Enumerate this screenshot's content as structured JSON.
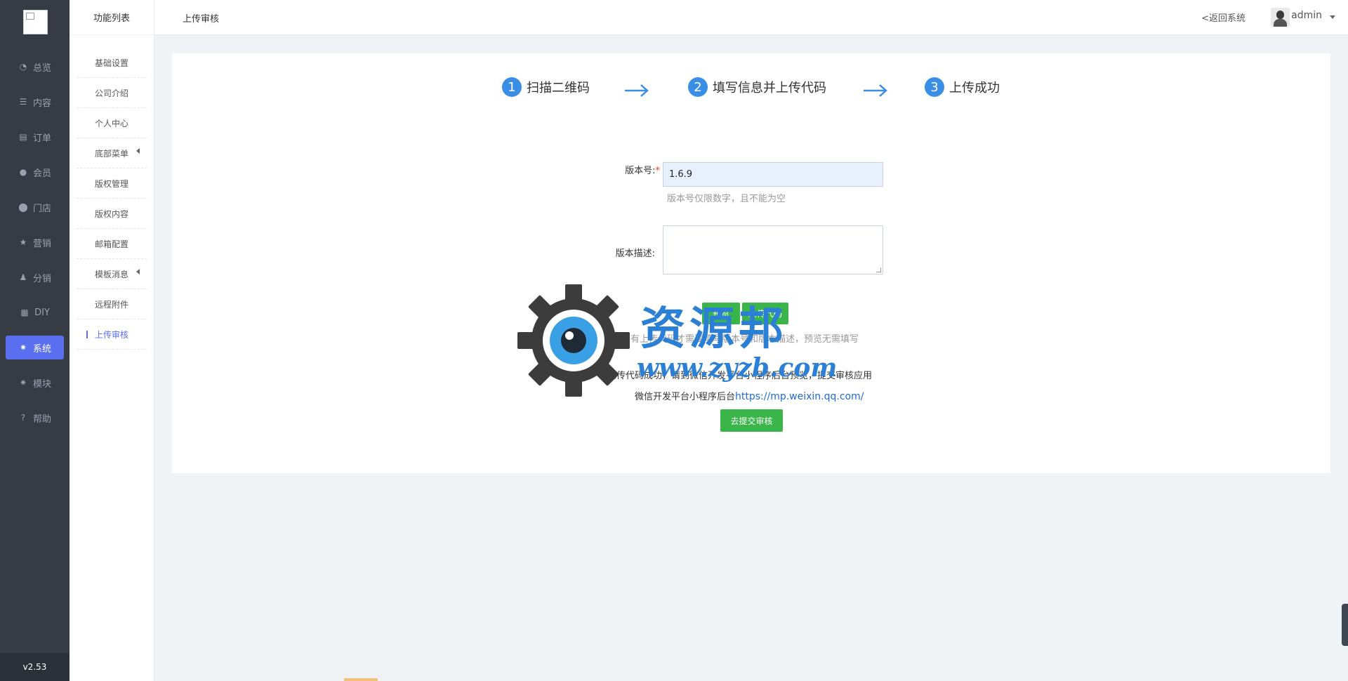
{
  "sidebar": {
    "items": [
      {
        "label": "总览",
        "icon": "pie-chart-icon",
        "glyph": "◔"
      },
      {
        "label": "内容",
        "icon": "list-icon",
        "glyph": "☰"
      },
      {
        "label": "订单",
        "icon": "order-icon",
        "glyph": "▤"
      },
      {
        "label": "会员",
        "icon": "user-icon",
        "glyph": "●"
      },
      {
        "label": "门店",
        "icon": "map-marker-icon",
        "glyph": "⬤"
      },
      {
        "label": "营销",
        "icon": "star-icon",
        "glyph": "★"
      },
      {
        "label": "分销",
        "icon": "users-icon",
        "glyph": "♟"
      },
      {
        "label": "DIY",
        "icon": "layout-icon",
        "glyph": "▦"
      },
      {
        "label": "系统",
        "icon": "gear-icon",
        "glyph": "✷",
        "active": true
      },
      {
        "label": "模块",
        "icon": "cog-icon",
        "glyph": "✷"
      },
      {
        "label": "帮助",
        "icon": "question-icon",
        "glyph": "?"
      }
    ],
    "version": "v2.53"
  },
  "submenu": {
    "title": "功能列表",
    "items": [
      {
        "label": "基础设置"
      },
      {
        "label": "公司介绍"
      },
      {
        "label": "个人中心"
      },
      {
        "label": "底部菜单",
        "has_caret": true
      },
      {
        "label": "版权管理"
      },
      {
        "label": "版权内容"
      },
      {
        "label": "邮箱配置"
      },
      {
        "label": "模板消息",
        "has_caret": true
      },
      {
        "label": "远程附件"
      },
      {
        "label": "上传审核",
        "active": true
      }
    ]
  },
  "header": {
    "title": "上传审核",
    "back_label": "<返回系统",
    "username": "admin"
  },
  "steps": [
    {
      "num": "1",
      "label": "扫描二维码"
    },
    {
      "num": "2",
      "label": "填写信息并上传代码"
    },
    {
      "num": "3",
      "label": "上传成功"
    }
  ],
  "form": {
    "version_label": "版本号:",
    "required_mark": "*",
    "version_value": "1.6.9",
    "version_hint": "版本号仅限数字，且不能为空",
    "desc_label": "版本描述:",
    "preview_button": "预览",
    "upload_button": "上传代码",
    "note_text": "只有上传代码才需要填写版本号和版本描述，预览无需填写",
    "success_text": "上传代码成功，请到微信开发平台小程序后台预览，提交审核应用",
    "platform_prefix": "微信开发平台小程序后台",
    "platform_link": "https://mp.weixin.qq.com/",
    "submit_button": "去提交审核"
  },
  "watermark": {
    "text": "资源邦",
    "url": "www.zyzb.com"
  },
  "colors": {
    "sidebar_bg": "#363b44",
    "active_accent": "#5a6ef0",
    "step_blue": "#3a8ee6",
    "button_green": "#39b54a",
    "link_blue": "#1e6bd6"
  }
}
